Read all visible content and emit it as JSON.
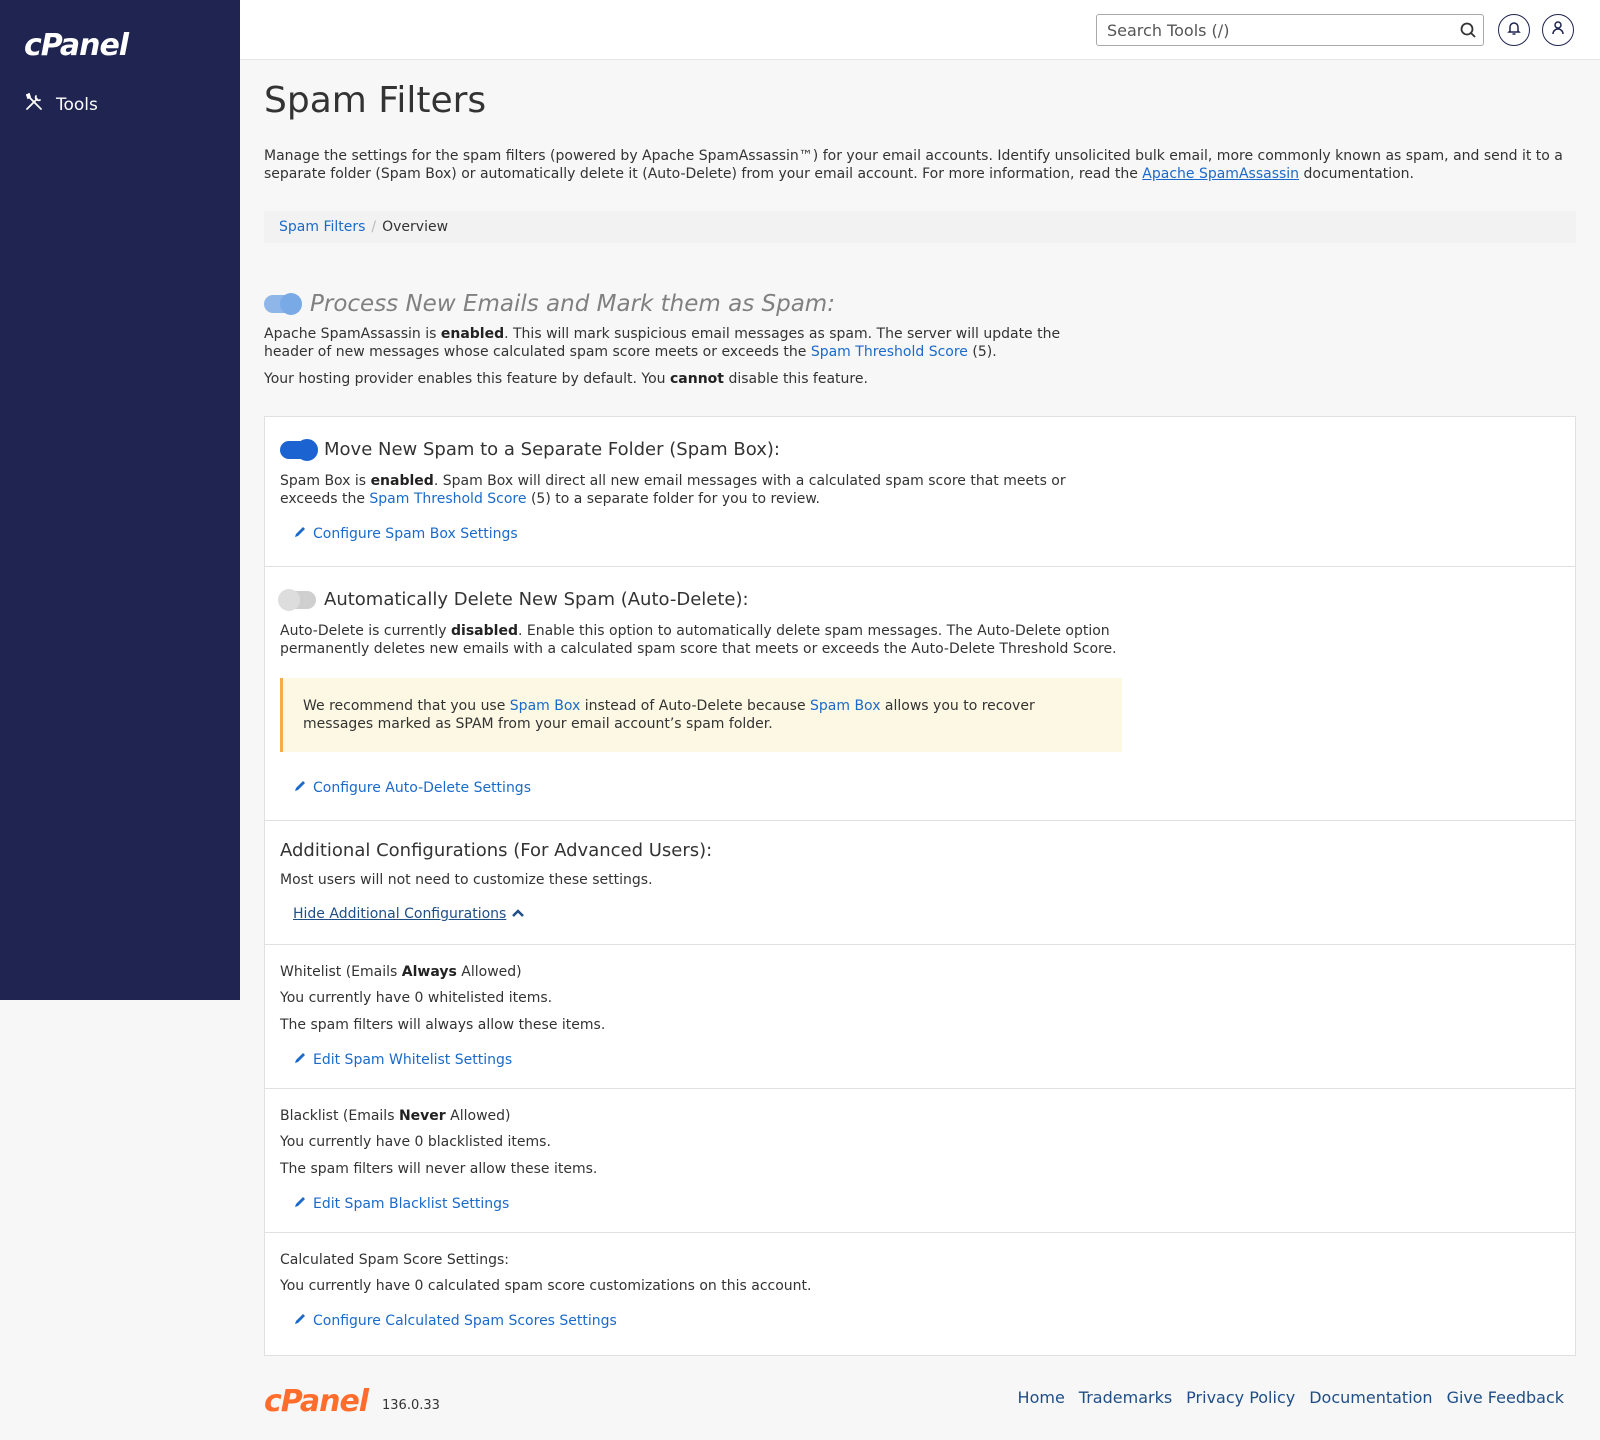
{
  "app": {
    "logo": "cPanel",
    "nav_tools": "Tools"
  },
  "search": {
    "placeholder": "Search Tools (/)"
  },
  "page": {
    "title": "Spam Filters",
    "desc_before": "Manage the settings for the spam filters (powered by Apache SpamAssassin™) for your email accounts. Identify unsolicited bulk email, more commonly known as spam, and send it to a separate folder (Spam Box) or automatically delete it (Auto-Delete) from your email account. For more information, read the ",
    "desc_link": "Apache SpamAssassin",
    "desc_after": " documentation."
  },
  "breadcrumb": {
    "root": "Spam Filters",
    "separator": "/",
    "current": "Overview"
  },
  "process": {
    "title": "Process New Emails and Mark them as Spam:",
    "p1_a": "Apache SpamAssassin is ",
    "p1_b": "enabled",
    "p1_c": ". This will mark suspicious email messages as spam. The server will update the header of new messages whose calculated spam score meets or exceeds the ",
    "p1_link": "Spam Threshold Score",
    "p1_d": " (5).",
    "p2_a": "Your hosting provider enables this feature by default. You ",
    "p2_b": "cannot",
    "p2_c": " disable this feature."
  },
  "spambox": {
    "title": "Move New Spam to a Separate Folder (Spam Box):",
    "p_a": "Spam Box is ",
    "p_b": "enabled",
    "p_c": ". Spam Box will direct all new email messages with a calculated spam score that meets or exceeds the ",
    "p_link": "Spam Threshold Score",
    "p_d": " (5) to a separate folder for you to review.",
    "link": "Configure Spam Box Settings"
  },
  "autodelete": {
    "title": "Automatically Delete New Spam (Auto-Delete):",
    "p_a": "Auto-Delete is currently ",
    "p_b": "disabled",
    "p_c": ". Enable this option to automatically delete spam messages. The Auto-Delete option permanently deletes new emails with a calculated spam score that meets or exceeds the Auto-Delete Threshold Score.",
    "alert_a": "We recommend that you use ",
    "alert_link1": "Spam Box",
    "alert_b": " instead of Auto-Delete because ",
    "alert_link2": "Spam Box",
    "alert_c": " allows you to recover messages marked as SPAM from your email account’s spam folder.",
    "link": "Configure Auto-Delete Settings"
  },
  "additional": {
    "title": "Additional Configurations (For Advanced Users):",
    "p": "Most users will not need to customize these settings.",
    "toggle_link": "Hide Additional Configurations"
  },
  "whitelist": {
    "title_a": "Whitelist (Emails ",
    "title_b": "Always",
    "title_c": " Allowed)",
    "p1": "You currently have 0 whitelisted items.",
    "p2": "The spam filters will always allow these items.",
    "link": "Edit Spam Whitelist Settings"
  },
  "blacklist": {
    "title_a": "Blacklist (Emails ",
    "title_b": "Never",
    "title_c": " Allowed)",
    "p1": "You currently have 0 blacklisted items.",
    "p2": "The spam filters will never allow these items.",
    "link": "Edit Spam Blacklist Settings"
  },
  "scores": {
    "title": "Calculated Spam Score Settings:",
    "p": "You currently have 0 calculated spam score customizations on this account.",
    "link": "Configure Calculated Spam Scores Settings"
  },
  "footer": {
    "logo": "cPanel",
    "version": "136.0.33",
    "links": [
      "Home",
      "Trademarks",
      "Privacy Policy",
      "Documentation",
      "Give Feedback"
    ]
  },
  "colors": {
    "sidebar": "#1f2450",
    "link": "#1b6ac9",
    "brand_orange": "#ff6c2c",
    "toggle_on": "#1b63d1",
    "alert_bg": "#fcf8e3",
    "alert_border": "#f0ad4e"
  }
}
